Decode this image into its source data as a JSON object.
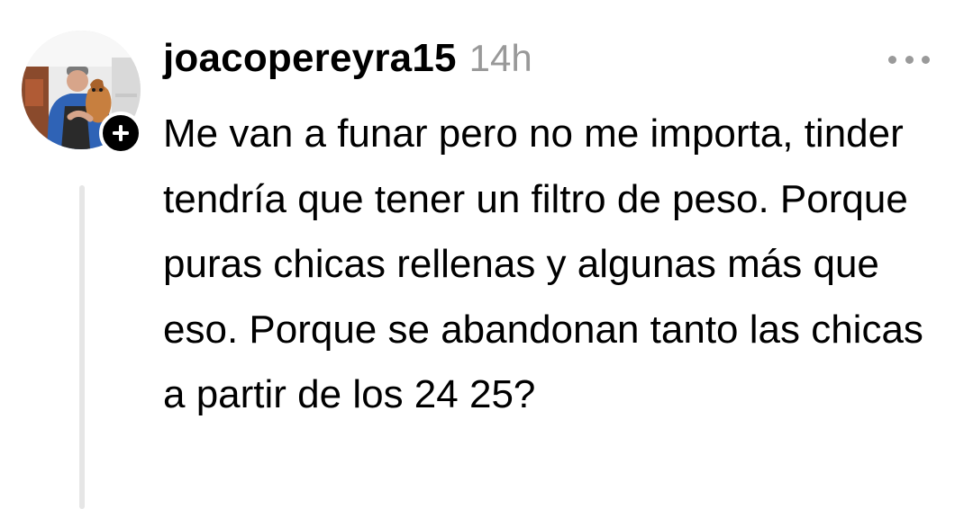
{
  "post": {
    "username": "joacopereyra15",
    "timestamp": "14h",
    "text": "Me van a funar pero no me importa, tinder tendría que tener un filtro de peso. Porque puras chicas rellenas y algunas más que eso. Porque se abandonan tanto las chicas a partir de los 24 25?",
    "avatar_icon": "profile-photo-person-holding-dog",
    "follow_icon": "plus-icon",
    "more_icon": "more-horizontal-icon"
  },
  "colors": {
    "text": "#000000",
    "muted": "#999999",
    "thread_line": "#e6e6e6",
    "background": "#ffffff"
  }
}
